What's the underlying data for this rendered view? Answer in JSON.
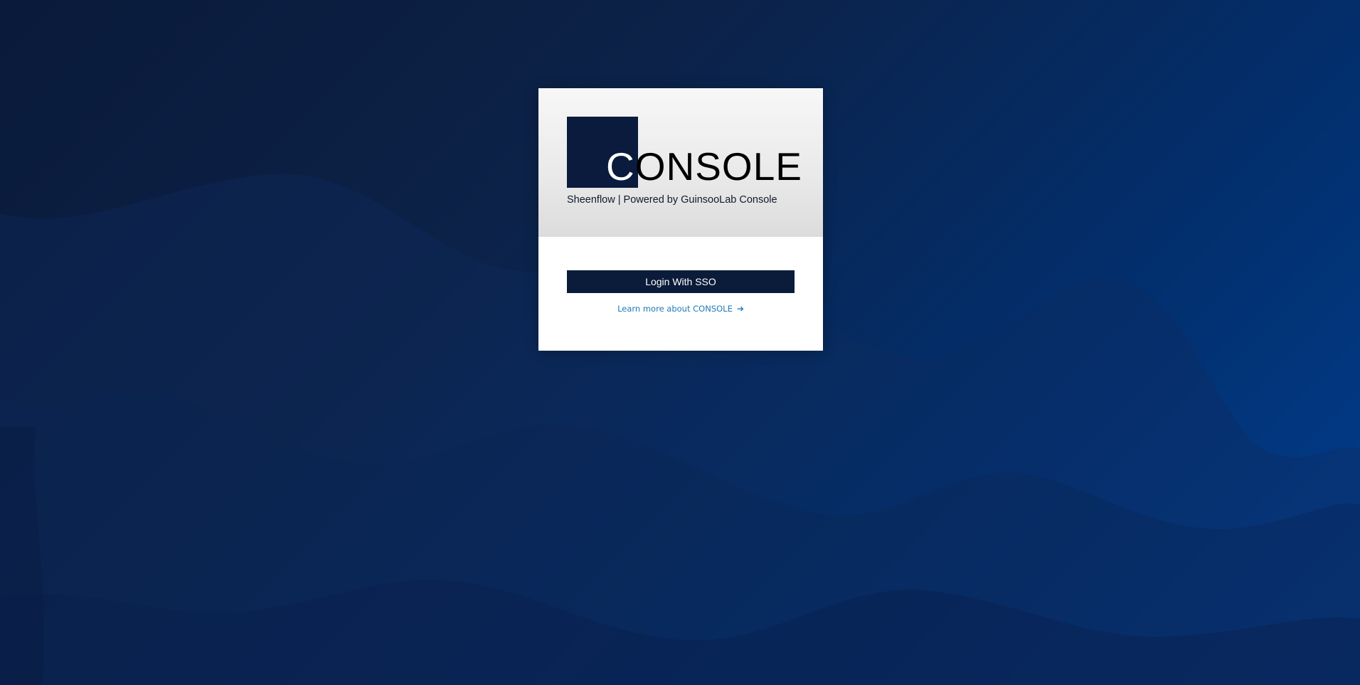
{
  "logo": {
    "first_letter": "C",
    "rest_text": "ONSOLE"
  },
  "tagline": "Sheenflow | Powered by GuinsooLab Console",
  "login": {
    "sso_label": "Login With SSO"
  },
  "learn_more": {
    "label": "Learn more about CONSOLE",
    "icon": "arrow-right-icon"
  },
  "colors": {
    "brand_dark": "#0a1b3d",
    "link": "#1f7ab8",
    "background_start": "#0a1a3a",
    "background_end": "#023f90"
  }
}
